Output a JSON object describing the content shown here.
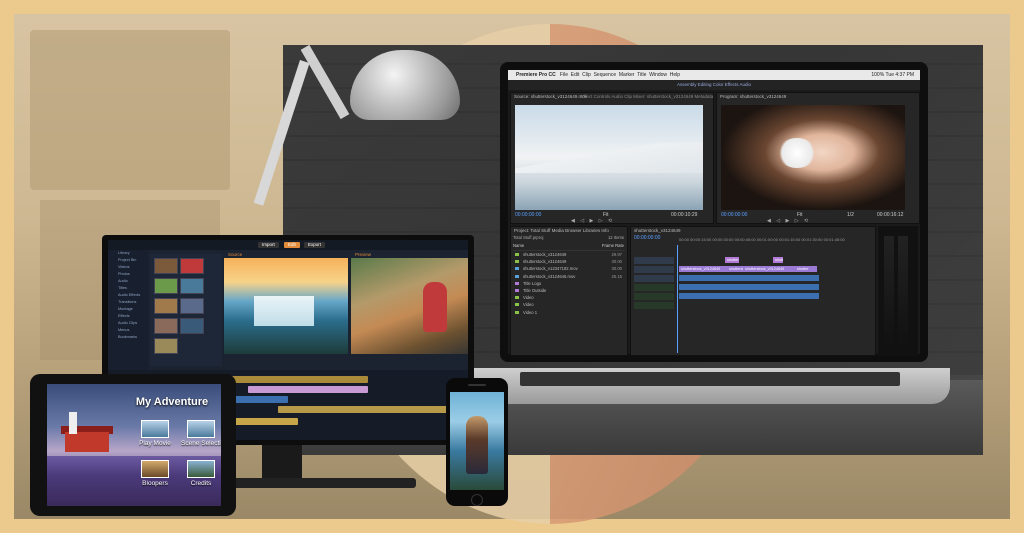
{
  "laptop": {
    "menubar": {
      "app": "Premiere Pro CC",
      "menus": [
        "File",
        "Edit",
        "Clip",
        "Sequence",
        "Marker",
        "Title",
        "Window",
        "Help"
      ],
      "battery": "100%",
      "clock": "Tue 4:37 PM"
    },
    "workspace_tabs": "Assembly   Editing   Color   Effects   Audio",
    "source_panel": {
      "title": "Source: shutterstock_v3124649.mov",
      "tabs": "Effect Controls   Audio Clip Mixer: shutterstock_v3124649   Metadata",
      "timecode_left": "00:00:00:00",
      "zoom": "Fit",
      "timecode_right": "00:00:10:29"
    },
    "program_panel": {
      "title": "Program: shutterstock_v3124649",
      "timecode_left": "00:00:00:00",
      "zoom": "Fit",
      "page": "1/2",
      "timecode_right": "00:00:16:12"
    },
    "project_panel": {
      "tabs": "Project: Total Stuff   Media Browser   Libraries   Info",
      "file": "Total Stuff.prproj",
      "count": "12 Items",
      "header_name": "Name",
      "header_rate": "Frame Rate",
      "rows": [
        {
          "name": "shutterstock_v3124649",
          "rate": "29.97",
          "color": "#8ac24a"
        },
        {
          "name": "shutterstock_v3124649",
          "rate": "30.00",
          "color": "#8ac24a"
        },
        {
          "name": "shutterstock_v12347182.mov",
          "rate": "30.00",
          "color": "#5aa0d6"
        },
        {
          "name": "shutterstock_v3124646.mov",
          "rate": "25.15",
          "color": "#5aa0d6"
        },
        {
          "name": "Title Logo",
          "rate": "",
          "color": "#b07ad6"
        },
        {
          "name": "Title Outside",
          "rate": "",
          "color": "#b07ad6"
        },
        {
          "name": "Video",
          "rate": "",
          "color": "#8ac24a"
        },
        {
          "name": "Video",
          "rate": "",
          "color": "#8ac24a"
        },
        {
          "name": "Video 1",
          "rate": "",
          "color": "#8ac24a"
        }
      ]
    },
    "timeline": {
      "tab": "shutterstock_v3124649",
      "timecode": "00:00:00:00",
      "ruler": "00:00   00:00:15:00   00:00:30:00   00:00:45:00   00:01:00:00   00:01:15:00   00:01:30:00   00:01:45:00",
      "clips": [
        "shutterstock_v3124649",
        "shutterstock_v3124649",
        "shutterstock_v3124649",
        "shutterstock",
        "shutterstock_v3124649",
        "shutter"
      ]
    }
  },
  "monitor": {
    "tabs": [
      "Import",
      "Edit",
      "Export"
    ],
    "preview_left_label": "Source",
    "preview_right_label": "Preview",
    "sidebar": [
      "Library",
      "Project Bin",
      "Videos",
      "Photos",
      "Audio",
      "Titles",
      "Audio Effects",
      "Transitions",
      "Montage",
      "Effects",
      "Audio Clips",
      "Menus",
      "Bookmarks"
    ]
  },
  "tablet": {
    "title": "My Adventure",
    "menu": [
      "Play Movie",
      "Scene Selection",
      "Bloopers",
      "Credits"
    ]
  },
  "colors": {
    "frame": "#ecc98c",
    "premiere_blue": "#5aa0ff",
    "clip_purple": "#9b7ad6",
    "clip_blue": "#3b6fb0",
    "studio_orange": "#e08a3a"
  }
}
